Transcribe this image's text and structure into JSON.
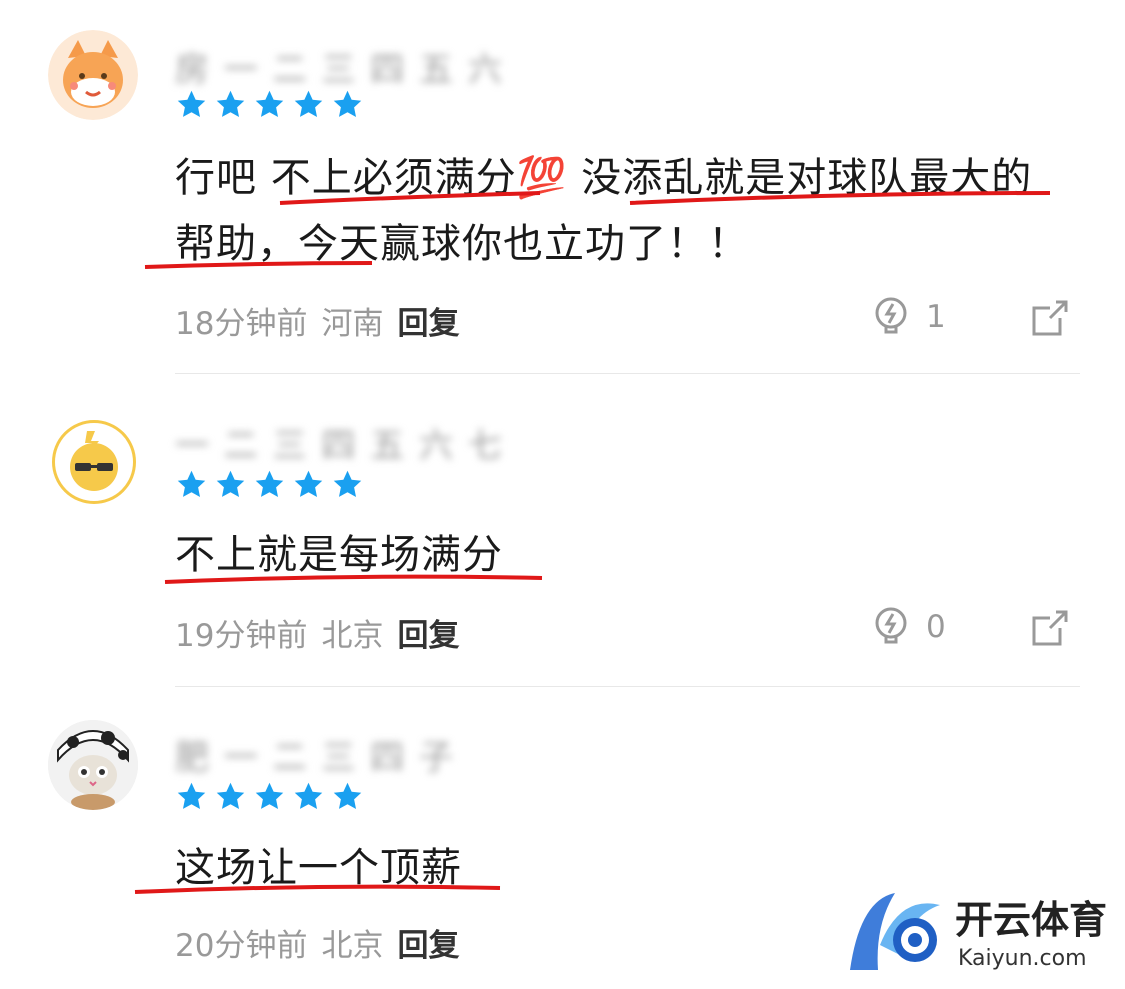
{
  "comments": [
    {
      "username": "房 一 二 三 四 五 六",
      "stars": 5,
      "content": "行吧 不上必须满分💯 没添乱就是对球队最大的帮助，今天赢球你也立功了！！",
      "time": "18分钟前",
      "location": "河南",
      "reply": "回复",
      "likes": "1"
    },
    {
      "username": "一 二 三 四 五 六 七",
      "stars": 5,
      "content": "不上就是每场满分",
      "time": "19分钟前",
      "location": "北京",
      "reply": "回复",
      "likes": "0"
    },
    {
      "username": "肥 一 二 三 四 子",
      "stars": 5,
      "content": "这场让一个顶薪",
      "time": "20分钟前",
      "location": "北京",
      "reply": "回复"
    }
  ],
  "watermark": {
    "brand": "开云体育",
    "domain": "Kaiyun.com"
  },
  "colors": {
    "star": "#1aa0f0",
    "underline": "#e01818",
    "meta": "#999999"
  }
}
